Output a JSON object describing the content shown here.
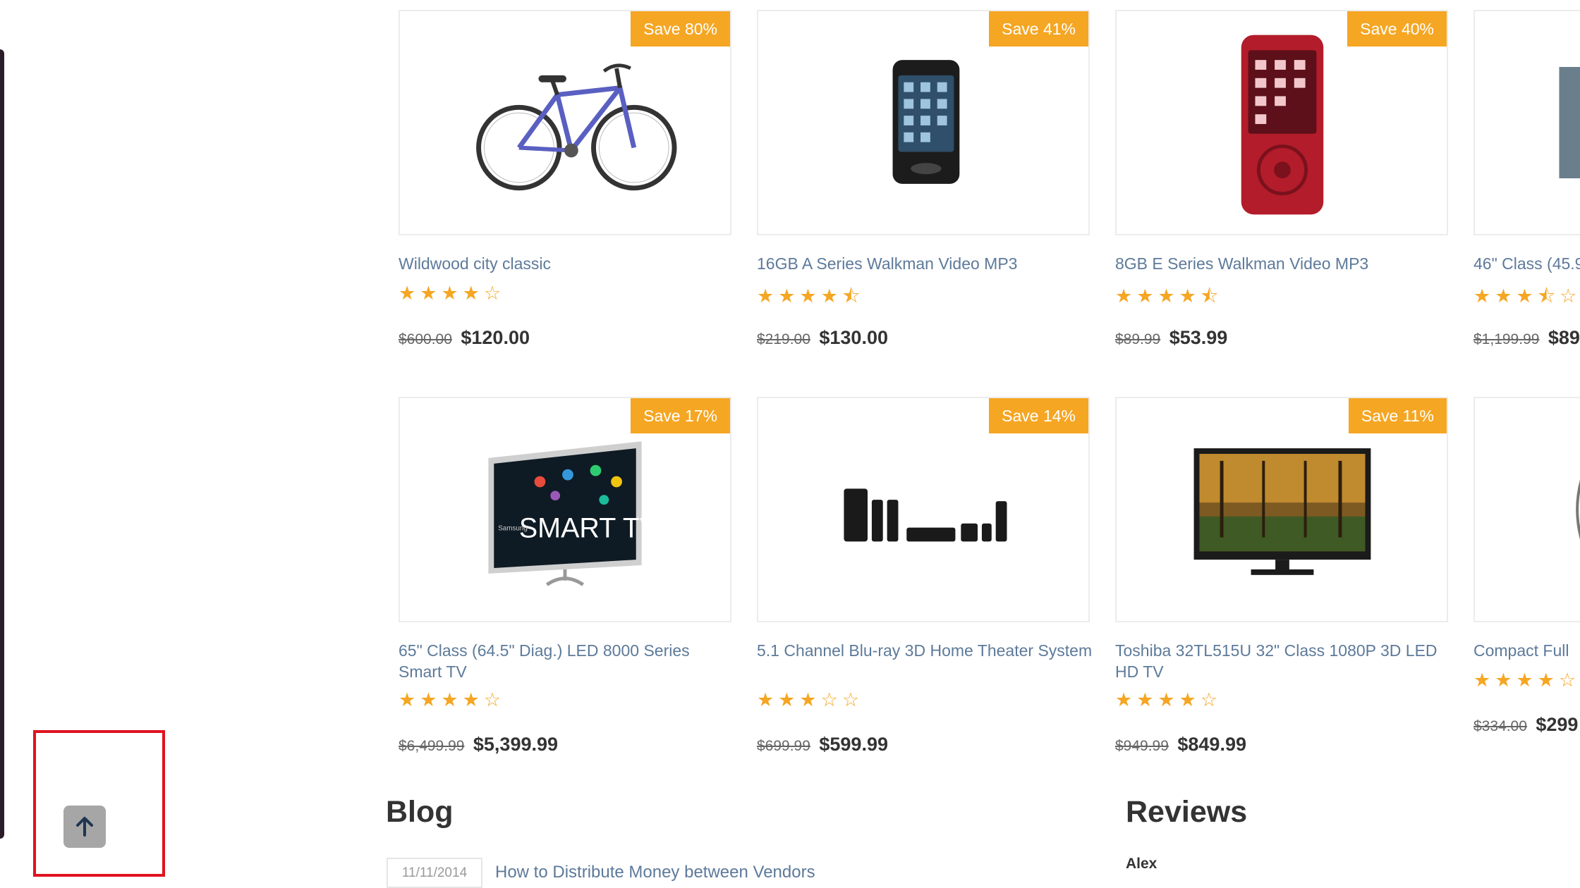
{
  "products": [
    {
      "badge": "Save 80%",
      "title": "Wildwood city classic",
      "rating_stars": "★★★★☆",
      "rating": 4,
      "old_price": "$600.00",
      "price": "$120.00",
      "image": "bicycle"
    },
    {
      "badge": "Save 41%",
      "title": "16GB A Series Walkman Video MP3",
      "rating_stars": "★★★★⯪",
      "rating": 4.5,
      "old_price": "$219.00",
      "price": "$130.00",
      "image": "black-walkman"
    },
    {
      "badge": "Save 40%",
      "title": "8GB E Series Walkman Video MP3",
      "rating_stars": "★★★★⯪",
      "rating": 4.5,
      "old_price": "$89.99",
      "price": "$53.99",
      "image": "red-walkman"
    },
    {
      "badge": "",
      "title": "46\" Class (45.9",
      "rating_stars": "★★★⯪☆",
      "rating": 3.5,
      "old_price": "$1,199.99",
      "price": "$89",
      "image": "tv-partial"
    },
    {
      "badge": "Save 17%",
      "title": "65\" Class (64.5\" Diag.) LED 8000 Series Smart TV",
      "rating_stars": "★★★★☆",
      "rating": 4,
      "old_price": "$6,499.99",
      "price": "$5,399.99",
      "image": "smart-tv",
      "smart_tv_text": "SMART TV",
      "smart_tv_brand": "Samsung"
    },
    {
      "badge": "Save 14%",
      "title": "5.1 Channel Blu-ray 3D Home Theater System",
      "rating_stars": "★★★☆☆",
      "rating": 3,
      "old_price": "$699.99",
      "price": "$599.99",
      "image": "home-theater"
    },
    {
      "badge": "Save 11%",
      "title": "Toshiba 32TL515U 32\" Class 1080P 3D LED HD TV",
      "rating_stars": "★★★★☆",
      "rating": 4,
      "old_price": "$949.99",
      "price": "$849.99",
      "image": "toshiba-tv"
    },
    {
      "badge": "",
      "title": "Compact Full",
      "rating_stars": "★★★★☆",
      "rating": 4,
      "old_price": "$334.00",
      "price": "$299",
      "image": "partial"
    }
  ],
  "blog": {
    "title": "Blog",
    "date": "11/11/2014",
    "post_title": "How to Distribute Money between Vendors"
  },
  "reviews": {
    "title": "Reviews",
    "author": "Alex"
  },
  "colors": {
    "badge": "#f5a623",
    "stars": "#f5a623",
    "link": "#5d7a9a",
    "highlight": "#e0121f"
  },
  "scroll_top": {
    "icon": "arrow-up-icon"
  }
}
